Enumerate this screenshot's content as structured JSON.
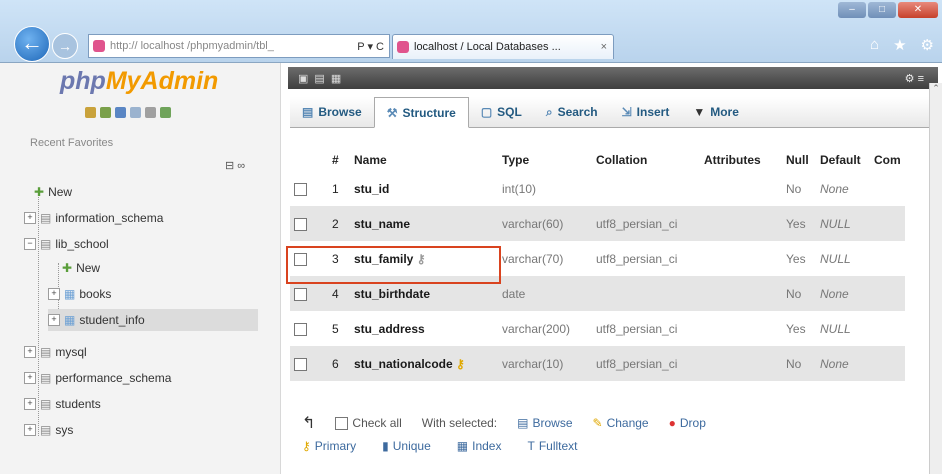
{
  "browser": {
    "url_domain": "localhost",
    "url_rest": "http:// localhost /phpmyadmin/tbl_",
    "url_tools": "P ▾ C",
    "tab_title": "localhost / Local Databases ...",
    "tab_close": "×"
  },
  "sidebar": {
    "logo_php": "php",
    "logo_myadmin": "MyAdmin",
    "recent_label": "Recent",
    "favorites_label": "Favorites",
    "tree": [
      {
        "label": "New",
        "level": 0
      },
      {
        "label": "information_schema",
        "level": 0
      },
      {
        "label": "lib_school",
        "level": 0
      },
      {
        "label": "New",
        "level": 1
      },
      {
        "label": "books",
        "level": 1
      },
      {
        "label": "student_info",
        "level": 1,
        "selected": true
      },
      {
        "label": "mysql",
        "level": 0
      },
      {
        "label": "performance_schema",
        "level": 0
      },
      {
        "label": "students",
        "level": 0
      },
      {
        "label": "sys",
        "level": 0
      }
    ]
  },
  "tabs": [
    {
      "label": "Browse",
      "icon": "browse-icon"
    },
    {
      "label": "Structure",
      "icon": "structure-icon",
      "active": true
    },
    {
      "label": "SQL",
      "icon": "sql-icon"
    },
    {
      "label": "Search",
      "icon": "search-icon"
    },
    {
      "label": "Insert",
      "icon": "insert-icon"
    },
    {
      "label": "More",
      "icon": "more-icon"
    }
  ],
  "table": {
    "headers": [
      "#",
      "Name",
      "Type",
      "Collation",
      "Attributes",
      "Null",
      "Default",
      "Com"
    ],
    "rows": [
      {
        "num": "1",
        "name": "stu_id",
        "type": "int(10)",
        "collation": "",
        "attributes": "",
        "null": "No",
        "default": "None",
        "key_icon": false
      },
      {
        "num": "2",
        "name": "stu_name",
        "type": "varchar(60)",
        "collation": "utf8_persian_ci",
        "attributes": "",
        "null": "Yes",
        "default": "NULL",
        "key_icon": false
      },
      {
        "num": "3",
        "name": "stu_family",
        "type": "varchar(70)",
        "collation": "utf8_persian_ci",
        "attributes": "",
        "null": "Yes",
        "default": "NULL",
        "key_icon": true
      },
      {
        "num": "4",
        "name": "stu_birthdate",
        "type": "date",
        "collation": "",
        "attributes": "",
        "null": "No",
        "default": "None",
        "key_icon": false
      },
      {
        "num": "5",
        "name": "stu_address",
        "type": "varchar(200)",
        "collation": "utf8_persian_ci",
        "attributes": "",
        "null": "Yes",
        "default": "NULL",
        "key_icon": false
      },
      {
        "num": "6",
        "name": "stu_nationalcode",
        "type": "varchar(10)",
        "collation": "utf8_persian_ci",
        "attributes": "",
        "null": "No",
        "default": "None",
        "key_icon": true
      }
    ]
  },
  "actions": {
    "check_all": "Check all",
    "with_selected": "With selected:",
    "browse": "Browse",
    "change": "Change",
    "drop": "Drop",
    "primary": "Primary",
    "unique": "Unique",
    "index": "Index",
    "fulltext": "Fulltext"
  },
  "colors": {
    "logo_php": "#6c78af",
    "logo_myadmin": "#f29a00",
    "highlight_box": "#d9431f"
  }
}
